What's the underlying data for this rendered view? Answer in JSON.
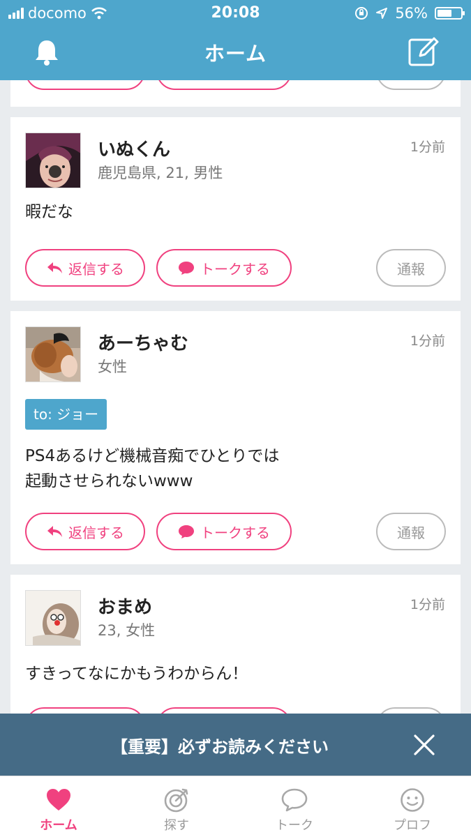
{
  "status_bar": {
    "carrier": "docomo",
    "time": "20:08",
    "battery": "56%"
  },
  "nav": {
    "title": "ホーム"
  },
  "posts": [
    {
      "name": "いぬくん",
      "meta": "鹿児島県, 21, 男性",
      "time": "1分前",
      "text": "暇だな",
      "to": "",
      "reply_label": "返信する",
      "talk_label": "トークする",
      "report_label": "通報"
    },
    {
      "name": "あーちゃむ",
      "meta": "女性",
      "time": "1分前",
      "to": "to: ジョー",
      "text_line1": "PS4あるけど機械音痴でひとりでは",
      "text_line2": "起動させられないwww",
      "reply_label": "返信する",
      "talk_label": "トークする",
      "report_label": "通報"
    },
    {
      "name": "おまめ",
      "meta": "23, 女性",
      "time": "1分前",
      "text": "すきってなにかもうわからん！"
    }
  ],
  "notice": {
    "text": "【重要】必ずお読みください"
  },
  "tabs": [
    {
      "label": "ホーム",
      "icon": "heart-icon",
      "active": true
    },
    {
      "label": "探す",
      "icon": "target-icon",
      "active": false
    },
    {
      "label": "トーク",
      "icon": "speech-bubble-icon",
      "active": false
    },
    {
      "label": "プロフ",
      "icon": "face-icon",
      "active": false
    }
  ],
  "colors": {
    "header": "#4ea6cc",
    "accent_pink": "#f0417f",
    "notice_bg": "#456b86"
  }
}
